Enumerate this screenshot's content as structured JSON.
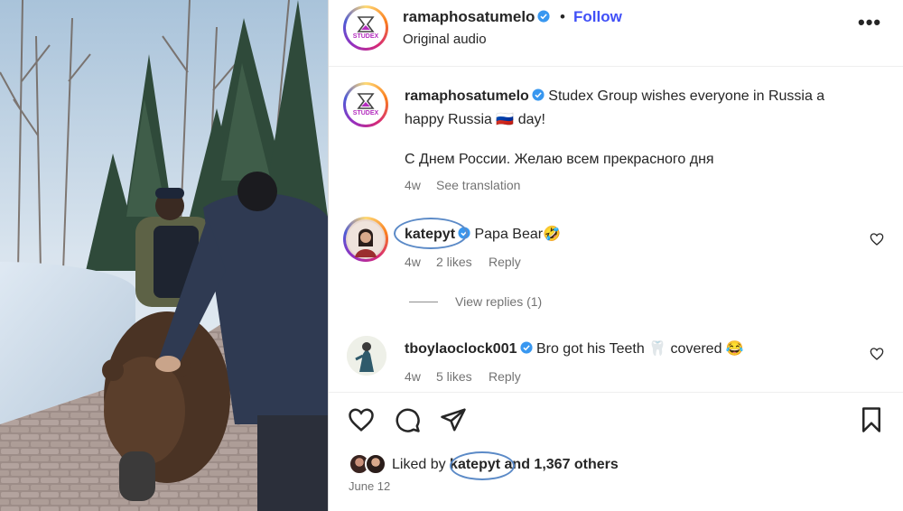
{
  "post": {
    "username": "ramaphosatumelo",
    "follow_label": "Follow",
    "separator": "•",
    "audio": "Original audio",
    "more_label": "•••",
    "logo_text_a": "STUD",
    "logo_text_b": "EX"
  },
  "caption": {
    "username": "ramaphosatumelo",
    "line1": "Studex Group wishes everyone in Russia a",
    "line2": "happy Russia 🇷🇺 day!",
    "line3": "С Днем России. Желаю всем прекрасного дня",
    "age": "4w",
    "translate": "See translation"
  },
  "comments": [
    {
      "username": "katepyt",
      "text": "Papa Bear🤣",
      "age": "4w",
      "likes": "2 likes",
      "reply": "Reply"
    },
    {
      "username": "tboylaoclock001",
      "text": "Bro got his Teeth 🦷 covered 😂",
      "age": "4w",
      "likes": "5 likes",
      "reply": "Reply"
    }
  ],
  "view_replies": "View replies (1)",
  "likes": {
    "prefix": "Liked by",
    "user": "katepyt",
    "suffix": "and 1,367 others"
  },
  "date": "June 12",
  "colors": {
    "accent": "#4150f7",
    "verified": "#3897f0",
    "annotation": "#5b8ac7"
  },
  "icons": [
    "heart-icon",
    "comment-icon",
    "share-icon",
    "bookmark-icon",
    "verified-icon",
    "more-icon"
  ]
}
